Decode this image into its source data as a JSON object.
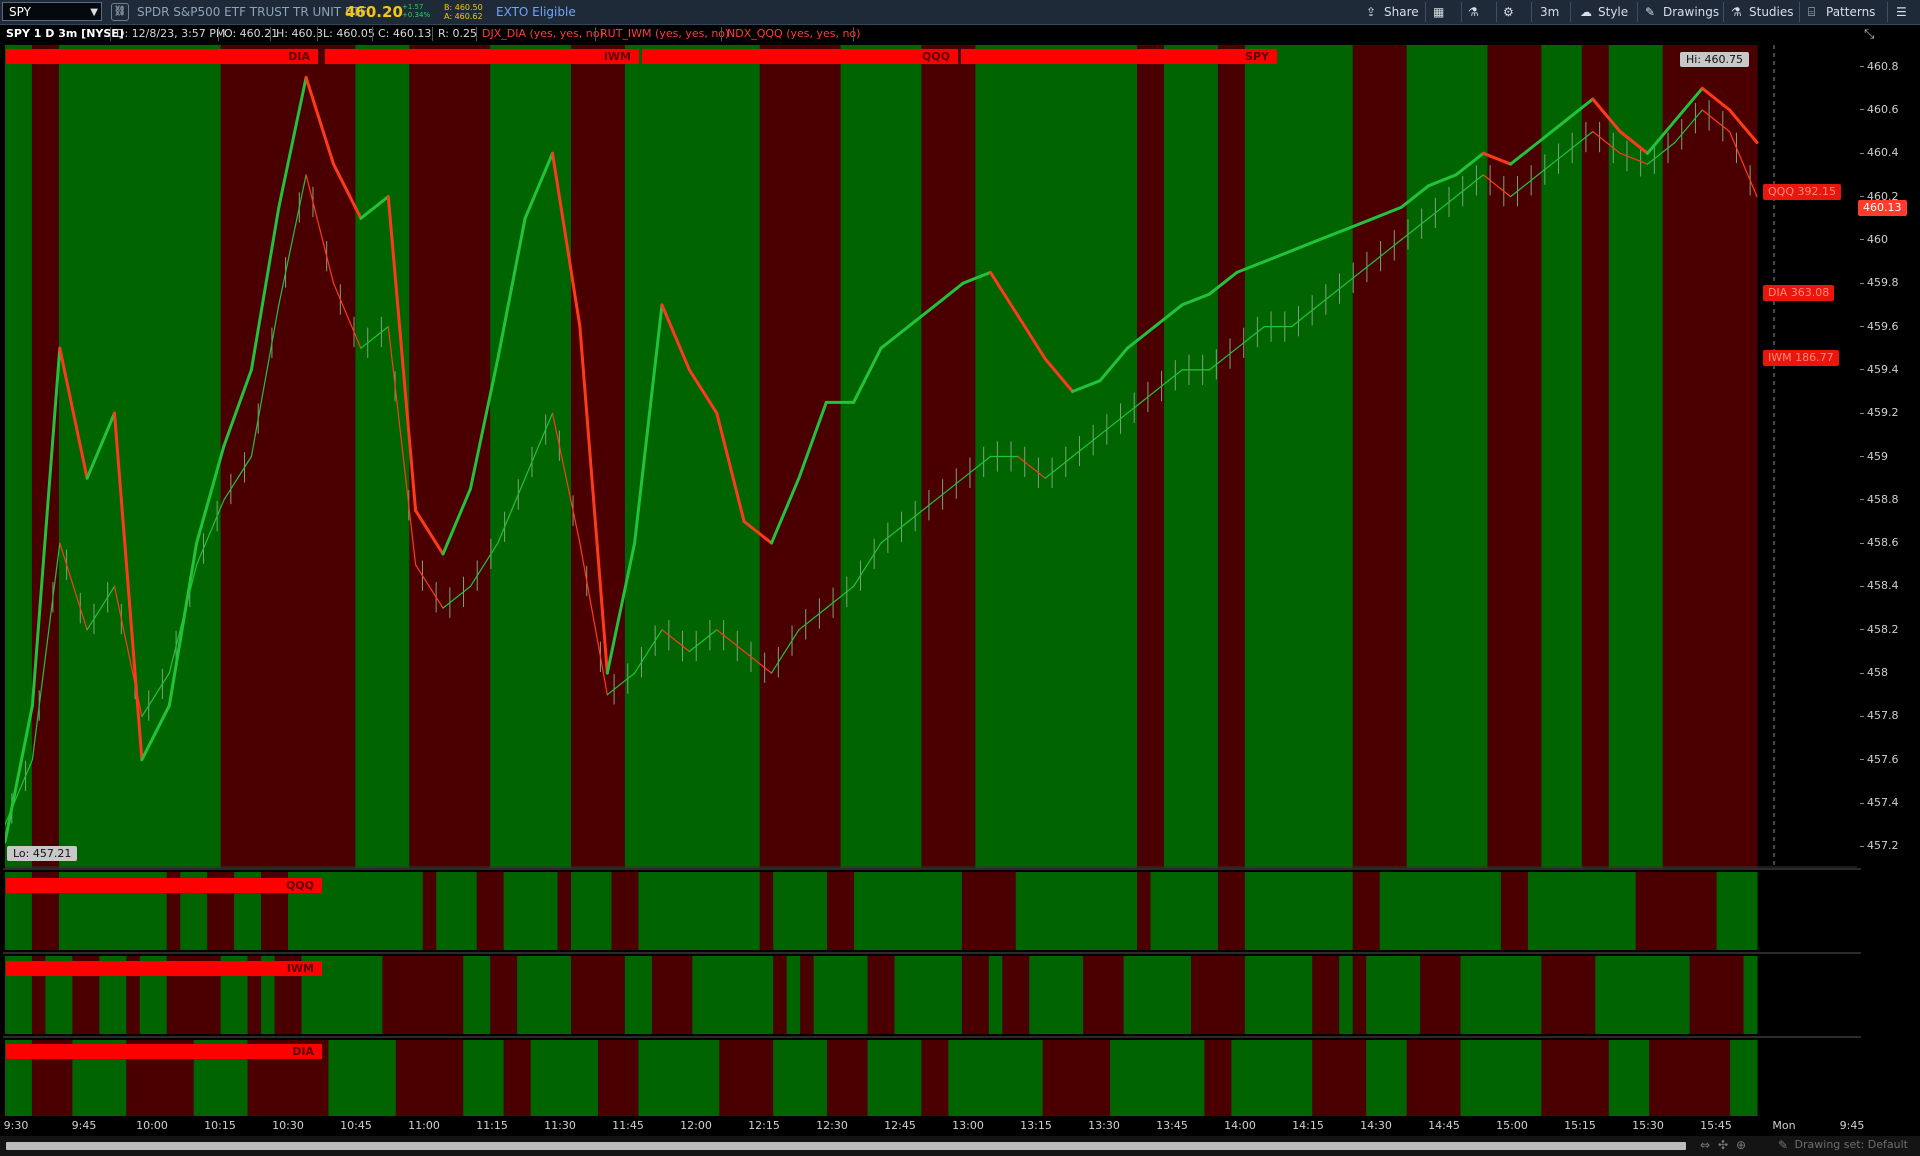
{
  "toolbar": {
    "symbol": "SPY",
    "description": "SPDR S&P500 ETF TRUST TR UNIT ETF",
    "last_price": "460.20",
    "net_change": "+1.57",
    "pct_change": "+0.34%",
    "bid": "B: 460.50",
    "ask": "A: 460.62",
    "exto": "EXTO Eligible",
    "share_label": "Share",
    "timeframe_label": "3m",
    "style_label": "Style",
    "drawings_label": "Drawings",
    "studies_label": "Studies",
    "patterns_label": "Patterns"
  },
  "info": {
    "title": "SPY 1 D 3m [NYSE]",
    "date": "D: 12/8/23, 3:57 PM",
    "open": "O: 460.21",
    "high": "H: 460.3",
    "low": "L: 460.05",
    "close": "C: 460.13",
    "range": "R: 0.25",
    "study1": "DJX_DIA (yes, yes, no)",
    "study2": "RUT_IWM (yes, yes, no)",
    "study3": "NDX_QQQ (yes, yes, no)"
  },
  "top_labels": [
    "DIA",
    "IWM",
    "QQQ",
    "SPY"
  ],
  "sub_labels": [
    "QQQ",
    "IWM",
    "DIA"
  ],
  "price_labels": {
    "hi": "Hi: 460.75",
    "lo": "Lo: 457.21",
    "qqq": "QQQ 392.15",
    "dia": "DIA 363.08",
    "iwm": "IWM 186.77",
    "current": "460.13"
  },
  "colors": {
    "up": "#006400",
    "down": "#4a0000",
    "empty": "#000000",
    "label": "#ff0000",
    "line_green": "#22c33a",
    "line_red": "#ff3a1a"
  },
  "chart_data": {
    "type": "line",
    "symbol": "SPY",
    "interval": "3m",
    "ylim": [
      457.1,
      460.9
    ],
    "y_ticks": [
      460.8,
      460.6,
      460.4,
      460.2,
      460,
      459.8,
      459.6,
      459.4,
      459.2,
      459,
      458.8,
      458.6,
      458.4,
      458.2,
      458,
      457.8,
      457.6,
      457.4,
      457.2
    ],
    "x_ticks": [
      "9:30",
      "9:45",
      "10:00",
      "10:15",
      "10:30",
      "10:45",
      "11:00",
      "11:15",
      "11:30",
      "11:45",
      "12:00",
      "12:15",
      "12:30",
      "12:45",
      "13:00",
      "13:15",
      "13:30",
      "13:45",
      "14:00",
      "14:15",
      "14:30",
      "14:45",
      "15:00",
      "15:15",
      "15:30",
      "15:45",
      "Mon",
      "9:45"
    ],
    "high": 460.75,
    "low": 457.21,
    "bars": 130,
    "signal_states": {
      "main": "GGDDGGGGGGGGGGGGDDDDDDDDDDGGGGDDDDDDGGGGGGDDDDGGGGGGGGGGDDDDDDGGGGGGDDDDGGGGGGGGGGGGDDGGGGDDGGGGGGGGDDDDGGGGGGDDDDGGGDDGGGGDDDDDDDD",
      "qqq": "GGDDGGGGGGGGDGGDDGGDDGGGGGGGGGGDGGGDDGGGGDGGGDDGGGGGGGGGDGGGGDDGGGGGGGGDDDDGGGGGGGGGDGGGGGDDGGGGGGGGDDGGGGGGGGGDDGGGGGGGGDDDDDD",
      "iwm": "GGDGGDDGGDGGDDDDGGDGDDGGGGGGDDDDDDGGDDGGGGDDDDGGDDDGGGGGGDGDGGGGDDGGGGGDDGDDGGGGDDDGGGGGDDDDGGGGGDDGDGGGGDDDGGGGGGDDDDGGGGGGGDDDDG",
      "dia": "GGDDDGGGGDDDDDGGGGDDDDDDGGGGGDDDDDGGGDDGGGGGDDDGGGGGGDDDDGGGGDDDGGGGDDGGGGGGGDDDDDGGGGGGGDDGGGGGGDDDDGGGDDDDGGGGGGDDDDDGGGDDDDDD"
    },
    "series": [
      {
        "role": "thick-line",
        "values": [
          457.22,
          457.85,
          459.5,
          458.9,
          459.2,
          457.6,
          457.85,
          458.6,
          459.05,
          459.4,
          460.15,
          460.75,
          460.35,
          460.1,
          460.2,
          458.75,
          458.55,
          458.85,
          459.45,
          460.1,
          460.4,
          459.6,
          458.0,
          458.6,
          459.7,
          459.4,
          459.2,
          458.7,
          458.6,
          458.9,
          459.25,
          459.25,
          459.5,
          459.6,
          459.7,
          459.8,
          459.85,
          459.65,
          459.45,
          459.3,
          459.35,
          459.5,
          459.6,
          459.7,
          459.75,
          459.85,
          459.9,
          459.95,
          460.0,
          460.05,
          460.1,
          460.15,
          460.25,
          460.3,
          460.4,
          460.35,
          460.45,
          460.55,
          460.65,
          460.5,
          460.4,
          460.55,
          460.7,
          460.6,
          460.45
        ]
      },
      {
        "role": "thin-line",
        "values": [
          457.3,
          457.6,
          458.6,
          458.2,
          458.4,
          457.8,
          458.0,
          458.5,
          458.8,
          459.0,
          459.7,
          460.3,
          459.8,
          459.5,
          459.6,
          458.5,
          458.3,
          458.4,
          458.6,
          458.9,
          459.2,
          458.6,
          457.9,
          458.0,
          458.2,
          458.1,
          458.2,
          458.1,
          458.0,
          458.2,
          458.3,
          458.4,
          458.6,
          458.7,
          458.8,
          458.9,
          459.0,
          459.0,
          458.9,
          459.0,
          459.1,
          459.2,
          459.3,
          459.4,
          459.4,
          459.5,
          459.6,
          459.6,
          459.7,
          459.8,
          459.9,
          460.0,
          460.1,
          460.2,
          460.3,
          460.2,
          460.3,
          460.4,
          460.5,
          460.4,
          460.35,
          460.45,
          460.6,
          460.5,
          460.2
        ]
      }
    ]
  }
}
